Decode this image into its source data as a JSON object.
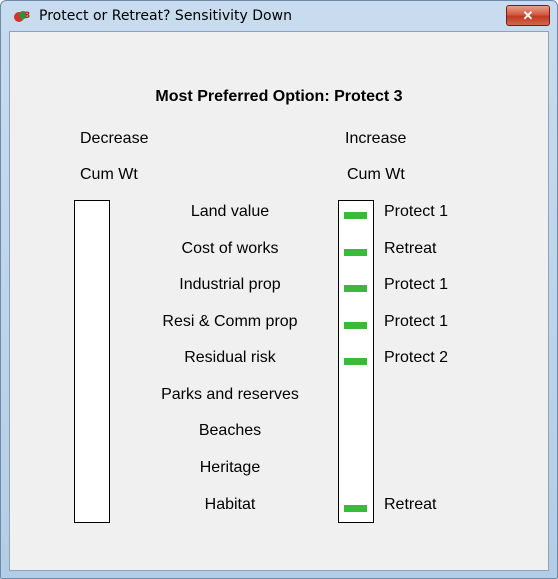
{
  "window": {
    "title": "Protect or Retreat? Sensitivity Down",
    "close_glyph": "✕"
  },
  "heading": "Most Preferred Option: Protect 3",
  "left_column": {
    "line1": "Decrease",
    "line2": "Cum Wt"
  },
  "right_column": {
    "line1": "Increase",
    "line2": "Cum Wt"
  },
  "accent": "#3cb83c",
  "criteria": [
    {
      "label": "Land value",
      "increase_result": "Protect 1"
    },
    {
      "label": "Cost of works",
      "increase_result": "Retreat"
    },
    {
      "label": "Industrial prop",
      "increase_result": "Protect 1"
    },
    {
      "label": "Resi & Comm prop",
      "increase_result": "Protect 1"
    },
    {
      "label": "Residual risk",
      "increase_result": "Protect 2"
    },
    {
      "label": "Parks and reserves",
      "increase_result": ""
    },
    {
      "label": "Beaches",
      "increase_result": ""
    },
    {
      "label": "Heritage",
      "increase_result": ""
    },
    {
      "label": "Habitat",
      "increase_result": "Retreat"
    }
  ]
}
